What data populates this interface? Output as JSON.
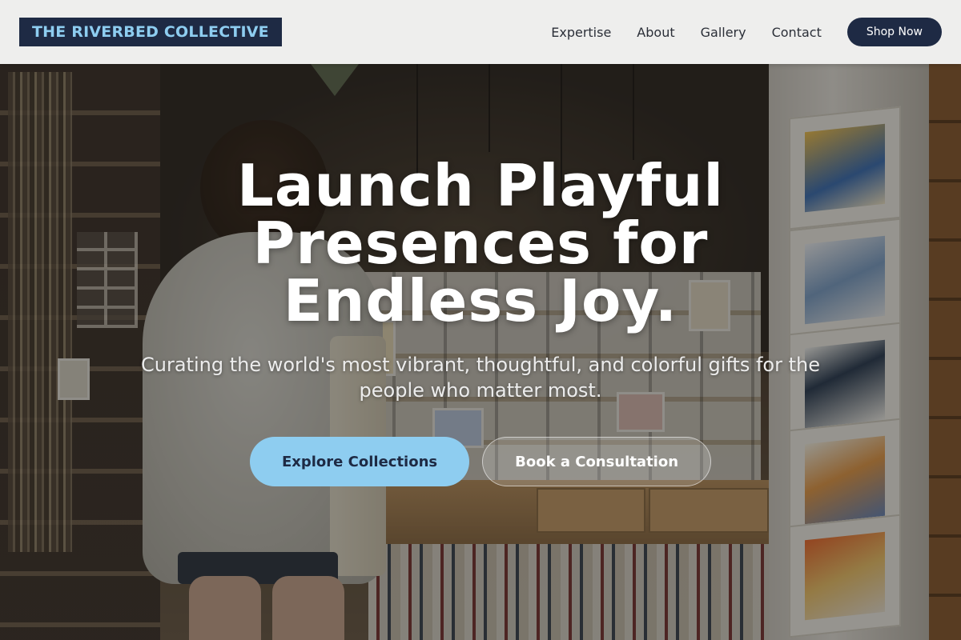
{
  "brand": {
    "name": "THE RIVERBED COLLECTIVE"
  },
  "nav": {
    "items": [
      {
        "label": "Expertise"
      },
      {
        "label": "About"
      },
      {
        "label": "Gallery"
      },
      {
        "label": "Contact"
      }
    ],
    "cta_label": "Shop Now"
  },
  "hero": {
    "headline": "Launch Playful Presences for Endless Joy.",
    "subtitle": "Curating the world's most vibrant, thoughtful, and colorful gifts for the people who matter most.",
    "primary_cta": "Explore Collections",
    "secondary_cta": "Book a Consultation"
  },
  "colors": {
    "navy": "#1e2a44",
    "sky": "#8ecdf0",
    "header_bg": "#f5f5f5"
  }
}
